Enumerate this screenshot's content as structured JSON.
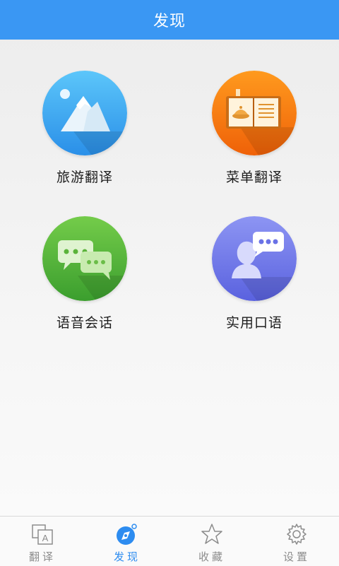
{
  "header": {
    "title": "发现"
  },
  "tiles": [
    {
      "label": "旅游翻译",
      "icon": "mountain-landscape-icon",
      "color": "#3aa7f2"
    },
    {
      "label": "菜单翻译",
      "icon": "menu-book-icon",
      "color": "#f57a12"
    },
    {
      "label": "语音会话",
      "icon": "chat-bubbles-icon",
      "color": "#4eb63c"
    },
    {
      "label": "实用口语",
      "icon": "speaker-person-icon",
      "color": "#6a77e8"
    }
  ],
  "tabbar": {
    "tabs": [
      {
        "label": "翻译",
        "icon": "translate-icon",
        "active": false
      },
      {
        "label": "发现",
        "icon": "compass-icon",
        "active": true
      },
      {
        "label": "收藏",
        "icon": "star-icon",
        "active": false
      },
      {
        "label": "设置",
        "icon": "gear-icon",
        "active": false
      }
    ],
    "active_color": "#2d8cf0",
    "inactive_color": "#8c8c8c"
  }
}
